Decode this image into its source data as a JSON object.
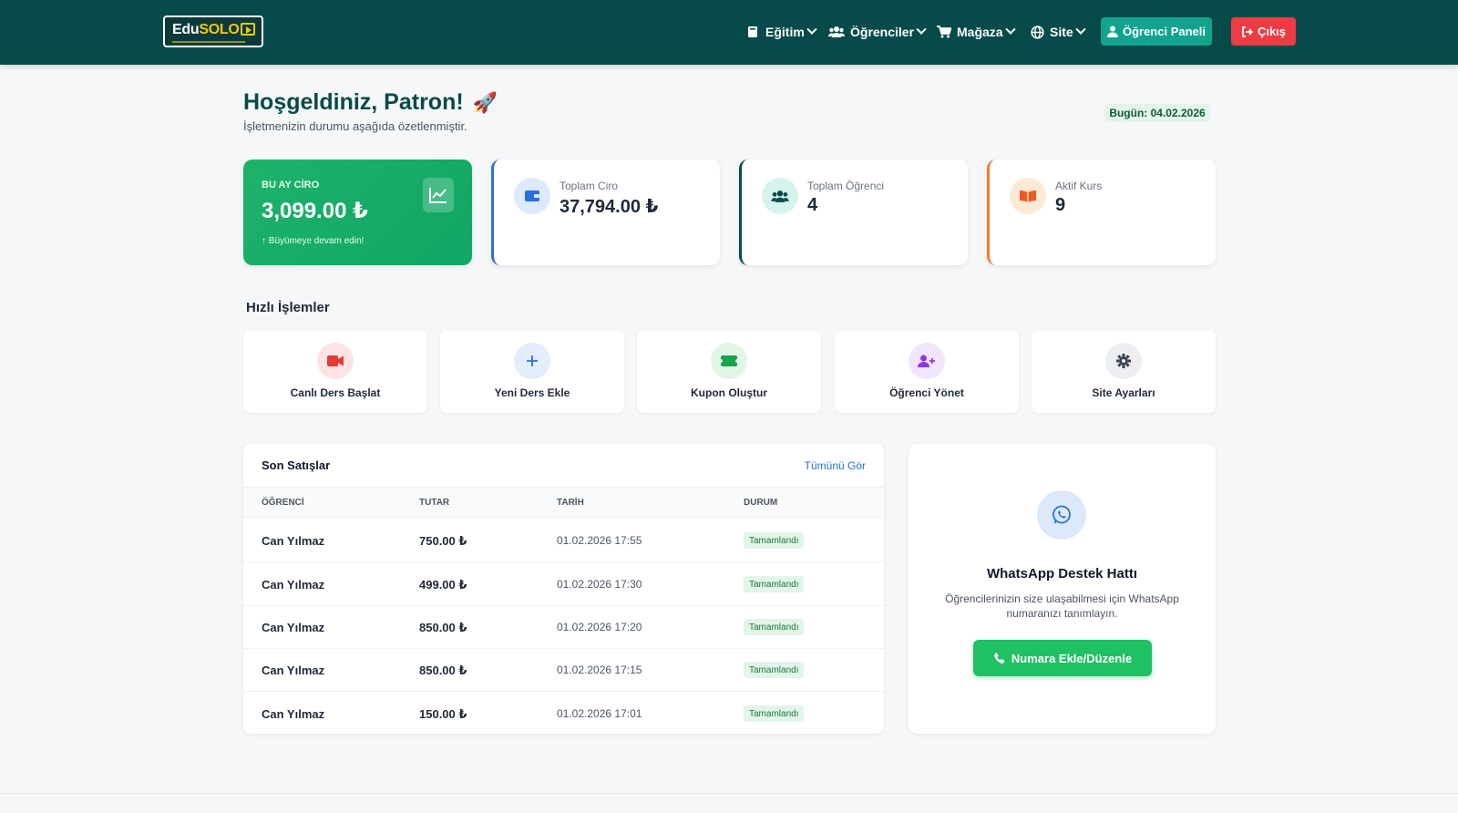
{
  "navbar": {
    "logo": {
      "edu": "Edu",
      "solo": "SOLO"
    },
    "menu": [
      {
        "label": "Eğitim",
        "icon": "book-icon"
      },
      {
        "label": "Öğrenciler",
        "icon": "users-icon"
      },
      {
        "label": "Mağaza",
        "icon": "cart-icon"
      },
      {
        "label": "Site",
        "icon": "globe-icon"
      }
    ],
    "student_panel_label": "Öğrenci Paneli",
    "logout_label": "Çıkış"
  },
  "header": {
    "title": "Hoşgeldiniz, Patron!",
    "emoji": "🚀",
    "subtitle": "İşletmenizin durumu aşağıda özetlenmiştir.",
    "date": "Bugün: 04.02.2026"
  },
  "stats": {
    "monthly": {
      "label": "BU AY CİRO",
      "value": "3,099.00 ₺",
      "note": "Büyümeye devam edin!"
    },
    "total_revenue": {
      "label": "Toplam Ciro",
      "value": "37,794.00 ₺"
    },
    "total_students": {
      "label": "Toplam Öğrenci",
      "value": "4"
    },
    "active_courses": {
      "label": "Aktif Kurs",
      "value": "9"
    }
  },
  "quick_actions": {
    "title": "Hızlı İşlemler",
    "items": [
      {
        "label": "Canlı Ders Başlat",
        "icon": "video-icon",
        "color": "#e53935",
        "bg": "#fde4e4"
      },
      {
        "label": "Yeni Ders Ekle",
        "icon": "plus-icon",
        "color": "#2a6fe0",
        "bg": "#e3edfb"
      },
      {
        "label": "Kupon Oluştur",
        "icon": "ticket-icon",
        "color": "#16a34a",
        "bg": "#e0f6e7"
      },
      {
        "label": "Öğrenci Yönet",
        "icon": "user-plus-icon",
        "color": "#9333ea",
        "bg": "#f1e6fc"
      },
      {
        "label": "Site Ayarları",
        "icon": "gear-icon",
        "color": "#374151",
        "bg": "#eceef1"
      }
    ]
  },
  "sales": {
    "title": "Son Satışlar",
    "view_all": "Tümünü Gör",
    "columns": [
      "ÖĞRENCİ",
      "TUTAR",
      "TARİH",
      "DURUM"
    ],
    "rows": [
      {
        "student": "Can Yılmaz",
        "amount": "750.00 ₺",
        "date": "01.02.2026 17:55",
        "status": "Tamamlandı"
      },
      {
        "student": "Can Yılmaz",
        "amount": "499.00 ₺",
        "date": "01.02.2026 17:30",
        "status": "Tamamlandı"
      },
      {
        "student": "Can Yılmaz",
        "amount": "850.00 ₺",
        "date": "01.02.2026 17:20",
        "status": "Tamamlandı"
      },
      {
        "student": "Can Yılmaz",
        "amount": "850.00 ₺",
        "date": "01.02.2026 17:15",
        "status": "Tamamlandı"
      },
      {
        "student": "Can Yılmaz",
        "amount": "150.00 ₺",
        "date": "01.02.2026 17:01",
        "status": "Tamamlandı"
      }
    ]
  },
  "whatsapp": {
    "title": "WhatsApp Destek Hattı",
    "description": "Öğrencilerinizin size ulaşabilmesi için WhatsApp numaranızı tanımlayın.",
    "button_label": "Numara Ekle/Düzenle"
  },
  "colors": {
    "navbar": "#064b4a",
    "accent_green": "#1fc163",
    "accent_blue": "#2a6fe0",
    "accent_orange": "#f47c26",
    "danger": "#ef3b42"
  }
}
